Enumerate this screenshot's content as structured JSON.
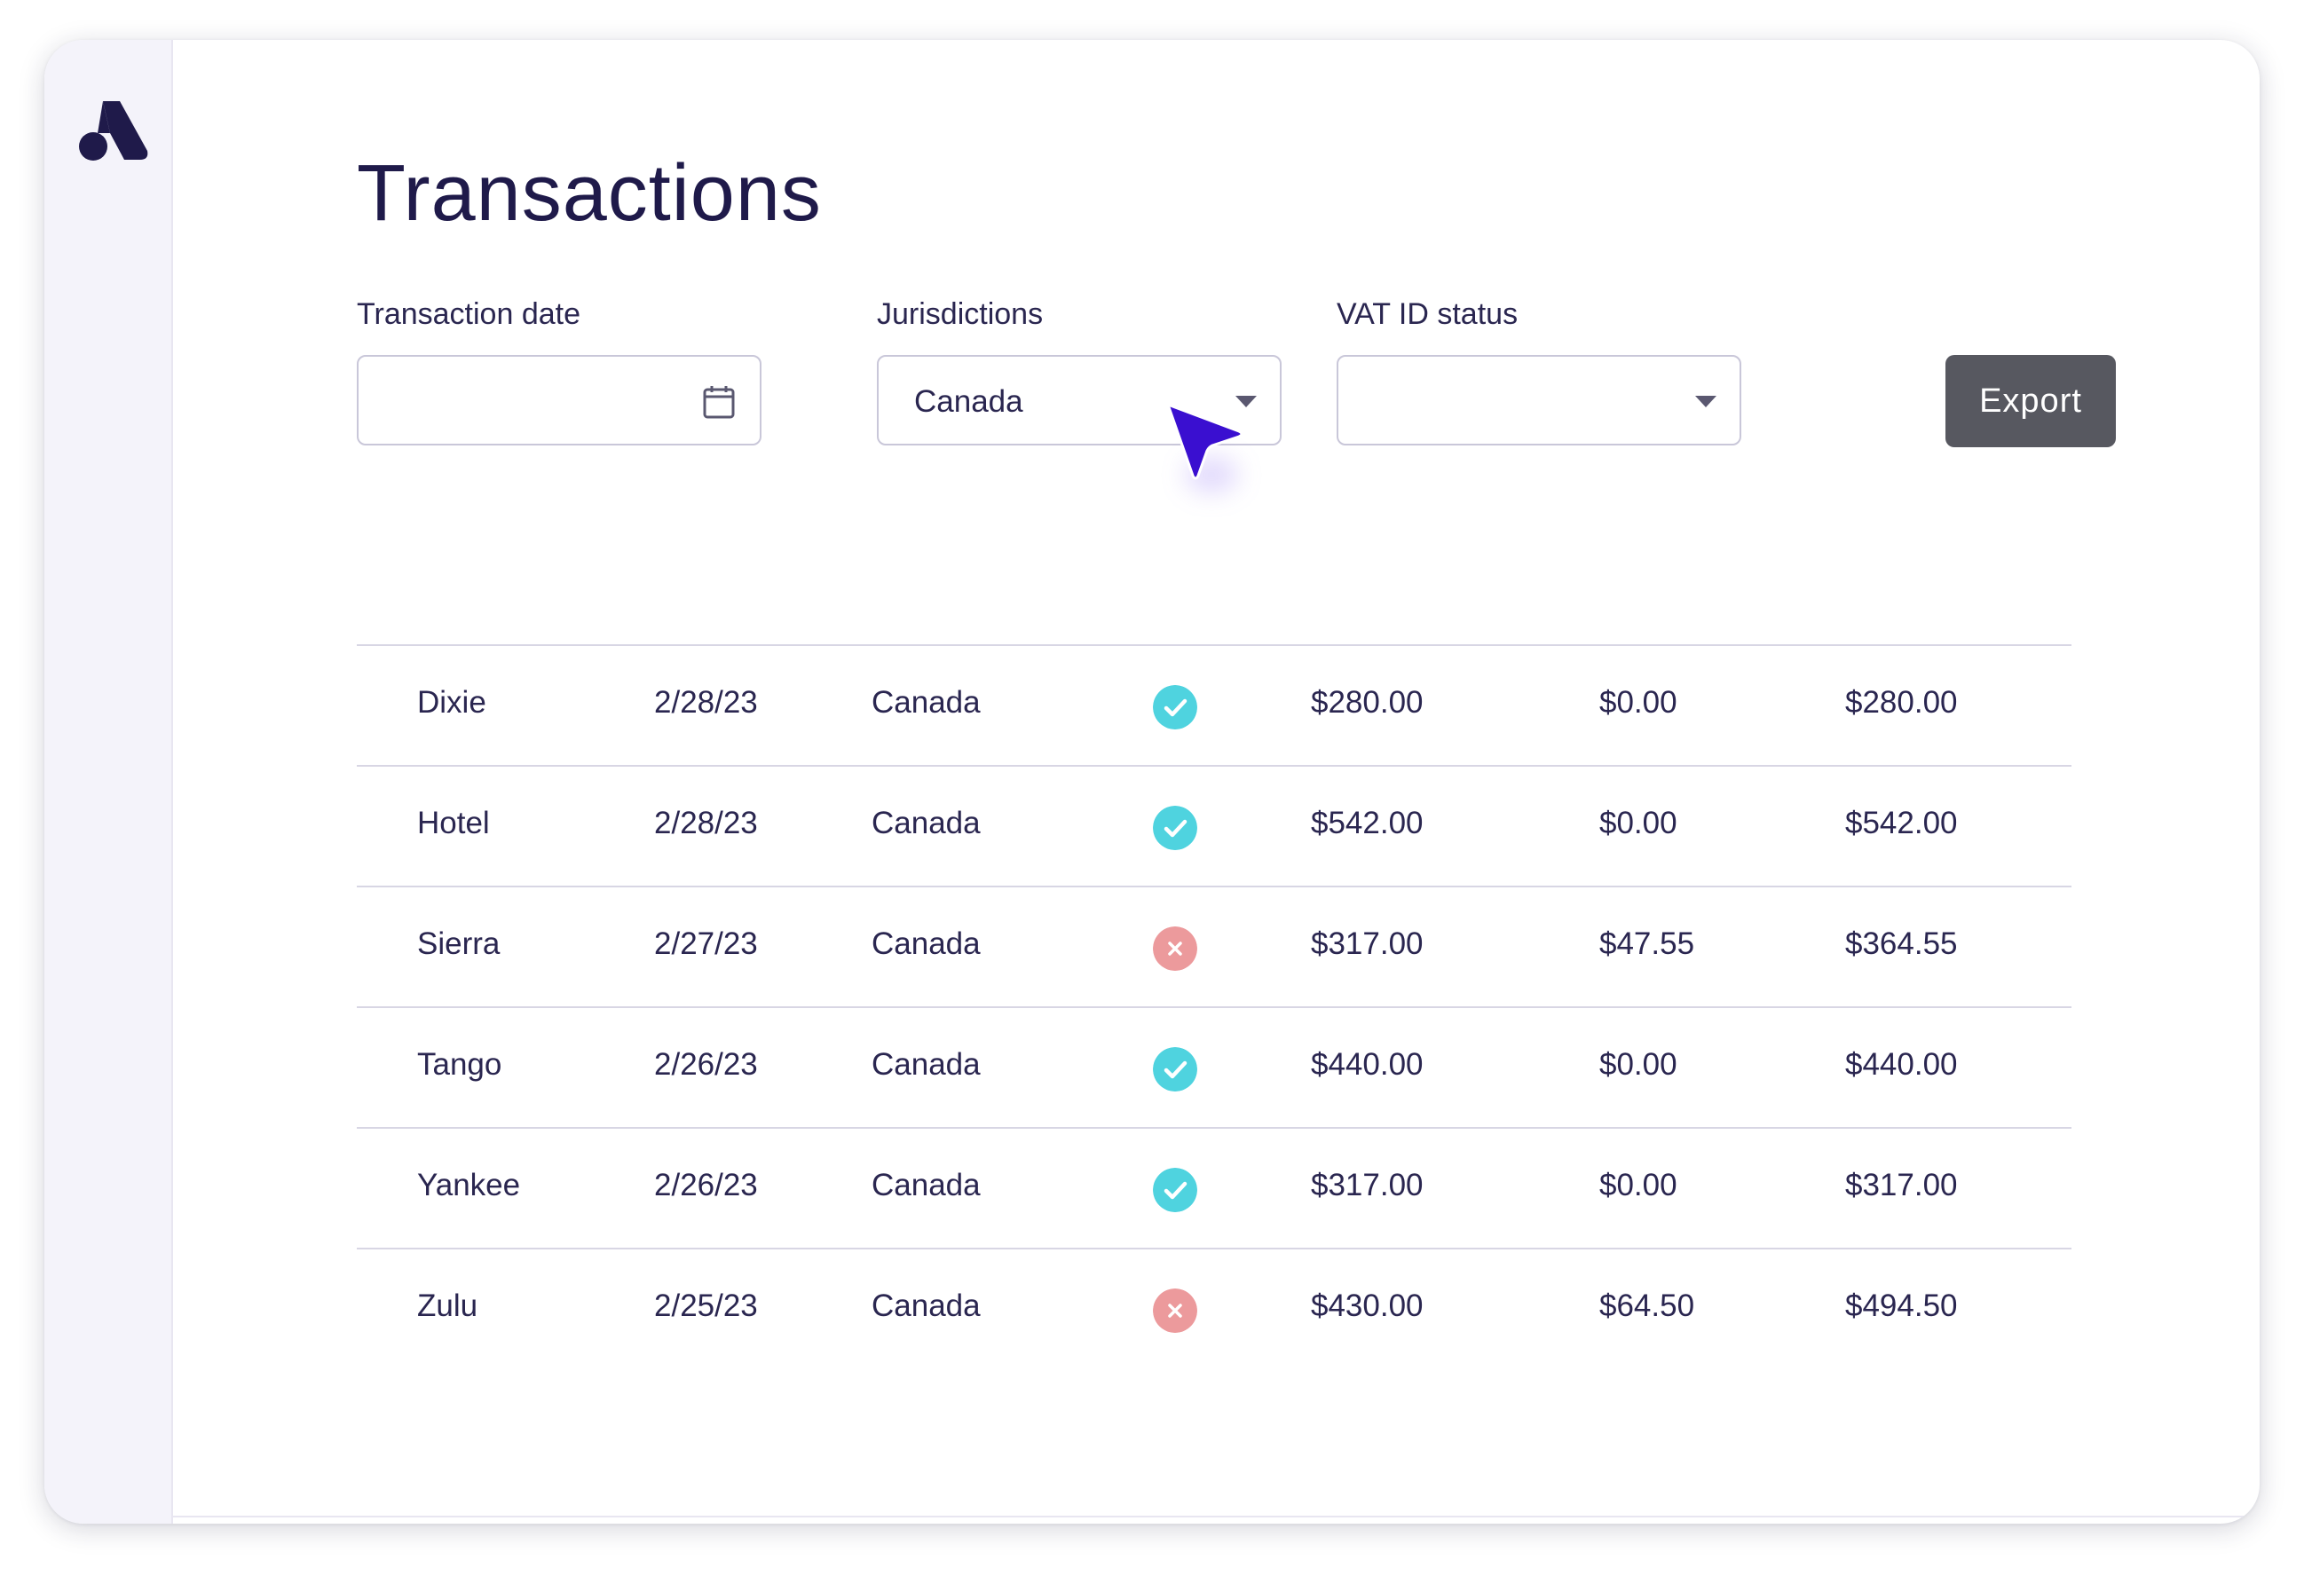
{
  "page": {
    "title": "Transactions"
  },
  "filters": {
    "transaction_date": {
      "label": "Transaction date",
      "value": ""
    },
    "jurisdictions": {
      "label": "Jurisdictions",
      "value": "Canada"
    },
    "vat_id_status": {
      "label": "VAT ID status",
      "value": ""
    }
  },
  "toolbar": {
    "export_label": "Export"
  },
  "colors": {
    "title": "#1f1a4a",
    "valid": "#4fd3df",
    "invalid": "#ec9a9c",
    "export_button": "#575860",
    "cursor": "#3a0fd0"
  },
  "transactions": [
    {
      "name": "Dixie",
      "date": "2/28/23",
      "jurisdiction": "Canada",
      "vat_valid": true,
      "amount": "$280.00",
      "tax": "$0.00",
      "total": "$280.00"
    },
    {
      "name": "Hotel",
      "date": "2/28/23",
      "jurisdiction": "Canada",
      "vat_valid": true,
      "amount": "$542.00",
      "tax": "$0.00",
      "total": "$542.00"
    },
    {
      "name": "Sierra",
      "date": "2/27/23",
      "jurisdiction": "Canada",
      "vat_valid": false,
      "amount": "$317.00",
      "tax": "$47.55",
      "total": "$364.55"
    },
    {
      "name": "Tango",
      "date": "2/26/23",
      "jurisdiction": "Canada",
      "vat_valid": true,
      "amount": "$440.00",
      "tax": "$0.00",
      "total": "$440.00"
    },
    {
      "name": "Yankee",
      "date": "2/26/23",
      "jurisdiction": "Canada",
      "vat_valid": true,
      "amount": "$317.00",
      "tax": "$0.00",
      "total": "$317.00"
    },
    {
      "name": "Zulu",
      "date": "2/25/23",
      "jurisdiction": "Canada",
      "vat_valid": false,
      "amount": "$430.00",
      "tax": "$64.50",
      "total": "$494.50"
    }
  ],
  "icons": {
    "logo": "brand-logo-icon",
    "date_picker": "calendar-icon",
    "dropdown": "chevron-down-icon",
    "valid": "check-circle-icon",
    "invalid": "x-circle-icon",
    "pointer": "cursor-arrow-icon"
  }
}
